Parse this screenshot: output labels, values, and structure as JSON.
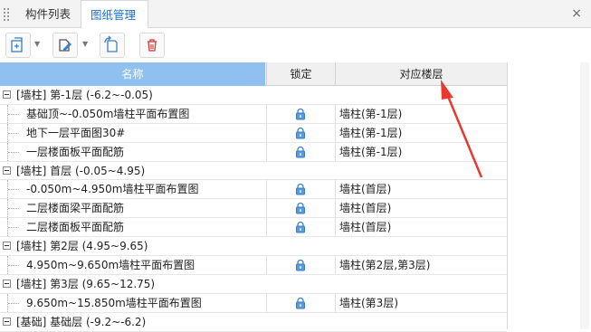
{
  "tabs": [
    {
      "label": "构件列表"
    },
    {
      "label": "图纸管理"
    }
  ],
  "close_label": "×",
  "table": {
    "headers": {
      "name": "名称",
      "lock": "锁定",
      "floor": "对应楼层"
    },
    "rows": [
      {
        "type": "group",
        "name": "[墙柱] 第-1层 (-6.2~-0.05)"
      },
      {
        "type": "leaf",
        "name": "基础顶~-0.050m墙柱平面布置图",
        "floor": "墙柱(第-1层)"
      },
      {
        "type": "leaf",
        "name": "地下一层平面图30#",
        "floor": "墙柱(第-1层)"
      },
      {
        "type": "leaf",
        "name": "一层楼面板平面配筋",
        "floor": "墙柱(第-1层)"
      },
      {
        "type": "group",
        "name": "[墙柱] 首层 (-0.05~4.95)"
      },
      {
        "type": "leaf",
        "name": "-0.050m~4.950m墙柱平面布置图",
        "floor": "墙柱(首层)"
      },
      {
        "type": "leaf",
        "name": "二层楼面梁平面配筋",
        "floor": "墙柱(首层)"
      },
      {
        "type": "leaf",
        "name": "二层楼面板平面配筋",
        "floor": "墙柱(首层)"
      },
      {
        "type": "group",
        "name": "[墙柱] 第2层 (4.95~9.65)"
      },
      {
        "type": "leaf",
        "name": "4.950m~9.650m墙柱平面布置图",
        "floor": "墙柱(第2层,第3层)"
      },
      {
        "type": "group",
        "name": "[墙柱] 第3层 (9.65~12.75)"
      },
      {
        "type": "leaf",
        "name": "9.650m~15.850m墙柱平面布置图",
        "floor": "墙柱(第3层)"
      },
      {
        "type": "group",
        "name": "[基础] 基础层 (-9.2~-6.2)"
      }
    ]
  },
  "icons": {
    "add": "add-drawing-icon",
    "edit": "edit-drawing-icon",
    "replace": "replace-drawing-icon",
    "delete": "delete-icon",
    "lock": "lock-icon"
  },
  "colors": {
    "header_accent": "#8fc0f0",
    "active_tab": "#1c6fd1",
    "annotation_arrow": "#e8392e"
  }
}
